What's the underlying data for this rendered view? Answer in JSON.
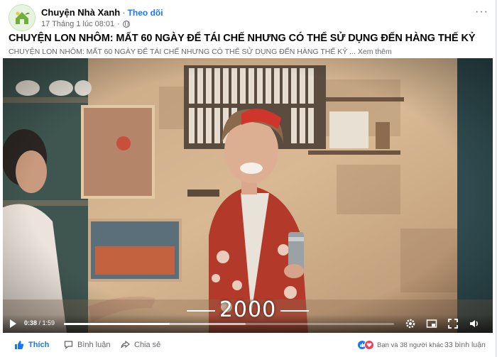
{
  "post": {
    "page_name": "Chuyện Nhà Xanh",
    "separator": "·",
    "follow_label": "Theo dõi",
    "timestamp": "17 Tháng 1 lúc 08:01",
    "meta_dot": "·",
    "more_label": "···",
    "title": "CHUYỆN LON NHÔM: MẤT 60 NGÀY ĐỂ TÁI CHẾ NHƯNG CÓ THỂ SỬ DỤNG ĐẾN HÀNG THẾ KỶ",
    "subtitle": "CHUYỆN LON NHÔM: MẤT 60 NGÀY ĐỂ TÁI CHẾ NHƯNG CÓ THỂ SỬ DỤNG ĐẾN HÀNG THẾ KỶ ...",
    "see_more": "Xem thêm"
  },
  "video": {
    "overlay_text": "2000",
    "current_time": "0:38",
    "duration": "/ 1:59",
    "progress": 0.32,
    "buffered": 0.55,
    "icons": [
      "play-icon",
      "gear-icon",
      "fullscreen-icon",
      "pip-icon",
      "volume-icon"
    ]
  },
  "footer": {
    "like_label": "Thích",
    "comment_label": "Bình luận",
    "share_label": "Chia sẻ",
    "reactions_text": "Bạn và 38 người khác",
    "comments_count": "33 bình luận"
  },
  "colors": {
    "accent": "#1877f2",
    "love": "#f33e58",
    "muted": "#65676b"
  }
}
